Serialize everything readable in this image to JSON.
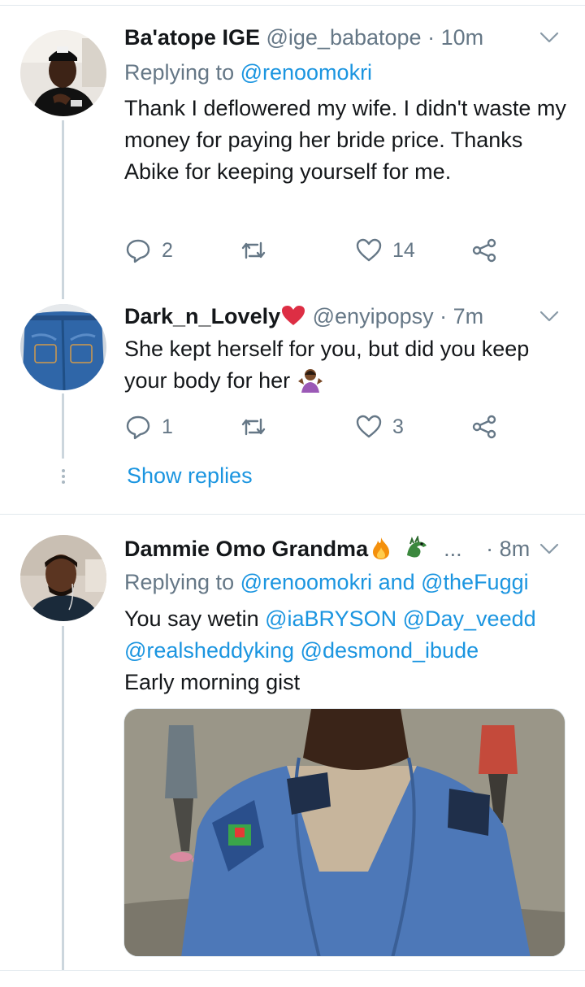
{
  "tweets": [
    {
      "name": "Ba'atope IGE",
      "handle": "@ige_babatope",
      "dot": "·",
      "time": "10m",
      "replying_prefix": "Replying to ",
      "replying_to": "@renoomokri",
      "text": "Thank I deflowered my wife. I didn't waste my money for paying her bride price. Thanks Abike for keeping yourself for me.",
      "reply_count": "2",
      "like_count": "14"
    },
    {
      "name": "Dark_n_Lovely",
      "name_emoji": "heart-icon",
      "handle": "@enyipopsy",
      "dot": "·",
      "time": "7m",
      "text": "She kept herself for you, but did you keep your body for her",
      "text_emoji": "woman-shrugging-icon",
      "reply_count": "1",
      "like_count": "3"
    },
    {
      "name": "Dammie Omo Grandma",
      "name_emojis": [
        "fire-icon",
        "dragon-icon"
      ],
      "ellipsis": "...",
      "dot": "·",
      "time": "8m",
      "replying_prefix": "Replying to ",
      "replying_to_1": "@renoomokri",
      "replying_and": " and ",
      "replying_to_2": "@theFuggi",
      "text_prefix": "You say wetin ",
      "mention_1": "@iaBRYSON",
      "mention_2": "@Day_veedd",
      "mention_3": "@realsheddyking",
      "mention_4": "@desmond_ibude",
      "text_line3": "Early morning gist"
    }
  ],
  "show_replies": "Show replies",
  "colors": {
    "link": "#1b95e0",
    "muted": "#657786",
    "divider": "#e1e8ed",
    "thread": "#ccd6dd"
  }
}
